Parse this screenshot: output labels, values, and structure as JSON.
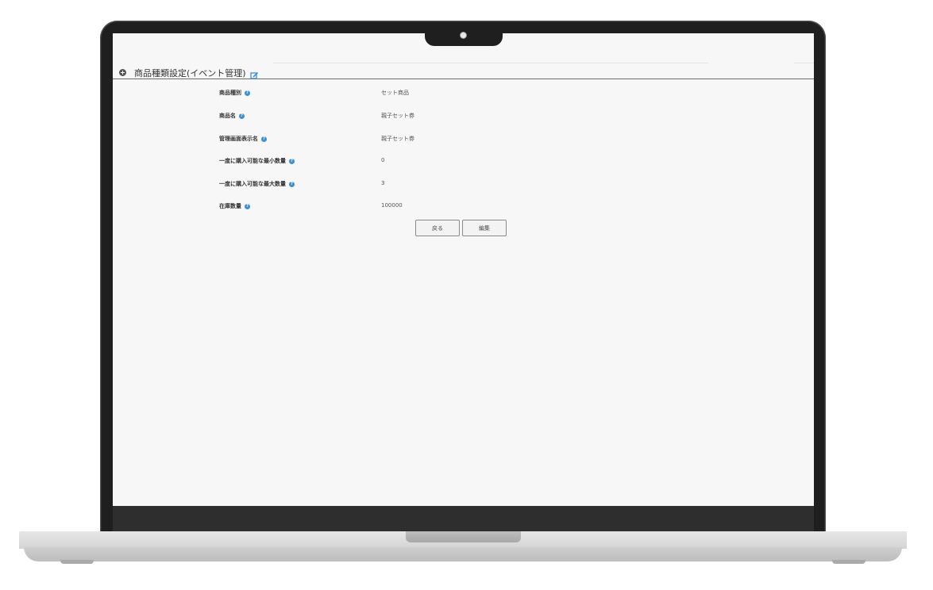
{
  "page": {
    "title": "商品種類設定(イベント管理)"
  },
  "fields": [
    {
      "label": "商品種別",
      "value": "セット商品"
    },
    {
      "label": "商品名",
      "value": "親子セット券"
    },
    {
      "label": "管理画面表示名",
      "value": "親子セット券"
    },
    {
      "label": "一度に購入可能な最小数量",
      "value": "0"
    },
    {
      "label": "一度に購入可能な最大数量",
      "value": "3"
    },
    {
      "label": "在庫数量",
      "value": "100000"
    }
  ],
  "buttons": {
    "back": "戻る",
    "edit": "編集"
  },
  "colors": {
    "accent": "#3f8fd0",
    "screen_bg": "#f7f7f7",
    "bezel": "#1f1f1f"
  },
  "icons": {
    "title_prefix": "circle-plus-icon",
    "title_suffix": "edit-icon",
    "field_help": "help-icon"
  }
}
